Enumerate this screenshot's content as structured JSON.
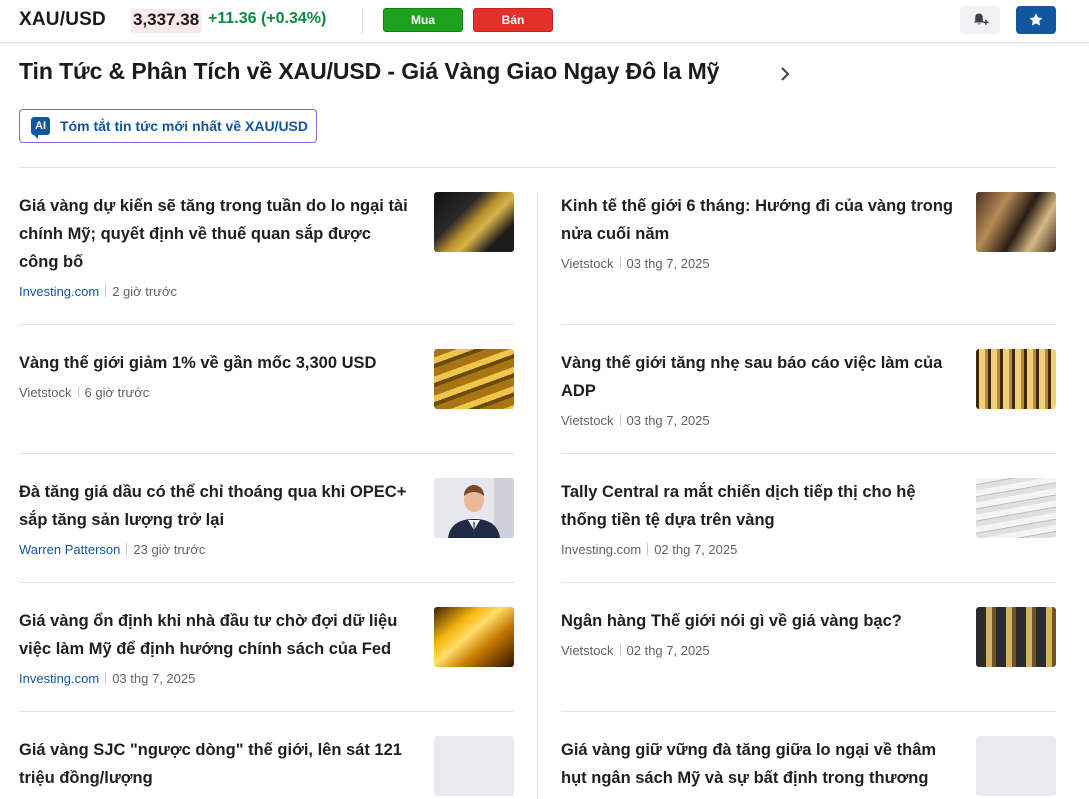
{
  "topbar": {
    "symbol": "XAU/USD",
    "price": "3,337.38",
    "change": "+11.36",
    "change_pct": "(+0.34%)",
    "buy_label": "Mua",
    "sell_label": "Bán",
    "alert_icon": "bell-plus-icon",
    "watchlist_icon": "star-icon"
  },
  "page": {
    "heading": "Tin Tức & Phân Tích về XAU/USD - Giá Vàng Giao Ngay Đô la Mỹ",
    "ai_summary_badge": "AI",
    "ai_summary_label": "Tóm tắt tin tức mới nhất về XAU/USD"
  },
  "colors": {
    "accent_blue": "#1256a0",
    "buy_green": "#1ea21e",
    "sell_red": "#e2302a",
    "positive": "#0b8a3e"
  },
  "articles_left": [
    {
      "title": "Giá vàng dự kiến sẽ tăng trong tuần do lo ngại tài chính Mỹ; quyết định về thuế quan sắp được công bố",
      "source": "Investing.com",
      "time": "2 giờ trước"
    },
    {
      "title": "Vàng thế giới giảm 1% về gần mốc 3,300 USD",
      "source": "Vietstock",
      "time": "6 giờ trước"
    },
    {
      "title": "Đà tăng giá dầu có thể chỉ thoáng qua khi OPEC+ sắp tăng sản lượng trở lại",
      "source": "Warren Patterson",
      "time": "23 giờ trước"
    },
    {
      "title": "Giá vàng ổn định khi nhà đầu tư chờ đợi dữ liệu việc làm Mỹ để định hướng chính sách của Fed",
      "source": "Investing.com",
      "time": "03 thg 7, 2025"
    },
    {
      "title": "Giá vàng SJC \"ngược dòng\" thế giới, lên sát 121 triệu đồng/lượng",
      "source": "",
      "time": ""
    }
  ],
  "articles_right": [
    {
      "title": "Kinh tế thế giới 6 tháng: Hướng đi của vàng trong nửa cuối năm",
      "source": "Vietstock",
      "time": "03 thg 7, 2025"
    },
    {
      "title": "Vàng thế giới tăng nhẹ sau báo cáo việc làm của ADP",
      "source": "Vietstock",
      "time": "03 thg 7, 2025"
    },
    {
      "title": "Tally Central ra mắt chiến dịch tiếp thị cho hệ thống tiền tệ dựa trên vàng",
      "source": "Investing.com",
      "time": "02 thg 7, 2025"
    },
    {
      "title": "Ngân hàng Thế giới nói gì về giá vàng bạc?",
      "source": "Vietstock",
      "time": "02 thg 7, 2025"
    },
    {
      "title": "Giá vàng giữ vững đà tăng giữa lo ngại về thâm hụt ngân sách Mỹ và sự bất định trong thương mại",
      "source": "",
      "time": ""
    }
  ]
}
